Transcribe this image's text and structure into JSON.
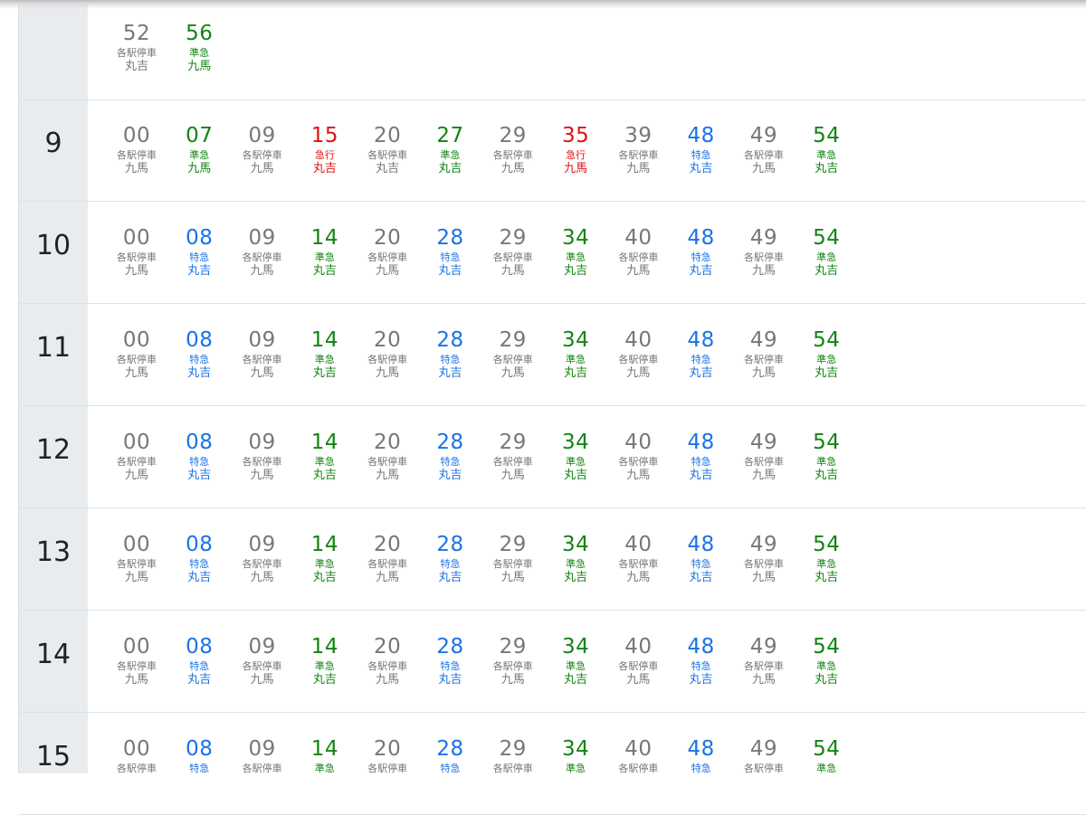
{
  "colors": {
    "local": "#777777",
    "semi_express": "#128412",
    "limited_express": "#1a73e8",
    "express": "#e01010"
  },
  "timetable": [
    {
      "hour": "",
      "trains": [
        {
          "minute": "52",
          "type": "各駅停車",
          "dest": "丸吉",
          "kind": "local"
        },
        {
          "minute": "56",
          "type": "準急",
          "dest": "九馬",
          "kind": "semi"
        }
      ]
    },
    {
      "hour": "9",
      "trains": [
        {
          "minute": "00",
          "type": "各駅停車",
          "dest": "九馬",
          "kind": "local"
        },
        {
          "minute": "07",
          "type": "準急",
          "dest": "九馬",
          "kind": "semi"
        },
        {
          "minute": "09",
          "type": "各駅停車",
          "dest": "九馬",
          "kind": "local"
        },
        {
          "minute": "15",
          "type": "急行",
          "dest": "丸吉",
          "kind": "exp"
        },
        {
          "minute": "20",
          "type": "各駅停車",
          "dest": "丸吉",
          "kind": "local"
        },
        {
          "minute": "27",
          "type": "準急",
          "dest": "丸吉",
          "kind": "semi"
        },
        {
          "minute": "29",
          "type": "各駅停車",
          "dest": "九馬",
          "kind": "local"
        },
        {
          "minute": "35",
          "type": "急行",
          "dest": "九馬",
          "kind": "exp"
        },
        {
          "minute": "39",
          "type": "各駅停車",
          "dest": "九馬",
          "kind": "local"
        },
        {
          "minute": "48",
          "type": "特急",
          "dest": "丸吉",
          "kind": "ltd"
        },
        {
          "minute": "49",
          "type": "各駅停車",
          "dest": "九馬",
          "kind": "local"
        },
        {
          "minute": "54",
          "type": "準急",
          "dest": "丸吉",
          "kind": "semi"
        }
      ]
    },
    {
      "hour": "10",
      "trains": [
        {
          "minute": "00",
          "type": "各駅停車",
          "dest": "九馬",
          "kind": "local"
        },
        {
          "minute": "08",
          "type": "特急",
          "dest": "丸吉",
          "kind": "ltd"
        },
        {
          "minute": "09",
          "type": "各駅停車",
          "dest": "九馬",
          "kind": "local"
        },
        {
          "minute": "14",
          "type": "準急",
          "dest": "丸吉",
          "kind": "semi"
        },
        {
          "minute": "20",
          "type": "各駅停車",
          "dest": "九馬",
          "kind": "local"
        },
        {
          "minute": "28",
          "type": "特急",
          "dest": "丸吉",
          "kind": "ltd"
        },
        {
          "minute": "29",
          "type": "各駅停車",
          "dest": "九馬",
          "kind": "local"
        },
        {
          "minute": "34",
          "type": "準急",
          "dest": "丸吉",
          "kind": "semi"
        },
        {
          "minute": "40",
          "type": "各駅停車",
          "dest": "九馬",
          "kind": "local"
        },
        {
          "minute": "48",
          "type": "特急",
          "dest": "丸吉",
          "kind": "ltd"
        },
        {
          "minute": "49",
          "type": "各駅停車",
          "dest": "九馬",
          "kind": "local"
        },
        {
          "minute": "54",
          "type": "準急",
          "dest": "丸吉",
          "kind": "semi"
        }
      ]
    },
    {
      "hour": "11",
      "trains": [
        {
          "minute": "00",
          "type": "各駅停車",
          "dest": "九馬",
          "kind": "local"
        },
        {
          "minute": "08",
          "type": "特急",
          "dest": "丸吉",
          "kind": "ltd"
        },
        {
          "minute": "09",
          "type": "各駅停車",
          "dest": "九馬",
          "kind": "local"
        },
        {
          "minute": "14",
          "type": "準急",
          "dest": "丸吉",
          "kind": "semi"
        },
        {
          "minute": "20",
          "type": "各駅停車",
          "dest": "九馬",
          "kind": "local"
        },
        {
          "minute": "28",
          "type": "特急",
          "dest": "丸吉",
          "kind": "ltd"
        },
        {
          "minute": "29",
          "type": "各駅停車",
          "dest": "九馬",
          "kind": "local"
        },
        {
          "minute": "34",
          "type": "準急",
          "dest": "丸吉",
          "kind": "semi"
        },
        {
          "minute": "40",
          "type": "各駅停車",
          "dest": "九馬",
          "kind": "local"
        },
        {
          "minute": "48",
          "type": "特急",
          "dest": "丸吉",
          "kind": "ltd"
        },
        {
          "minute": "49",
          "type": "各駅停車",
          "dest": "九馬",
          "kind": "local"
        },
        {
          "minute": "54",
          "type": "準急",
          "dest": "丸吉",
          "kind": "semi"
        }
      ]
    },
    {
      "hour": "12",
      "trains": [
        {
          "minute": "00",
          "type": "各駅停車",
          "dest": "九馬",
          "kind": "local"
        },
        {
          "minute": "08",
          "type": "特急",
          "dest": "丸吉",
          "kind": "ltd"
        },
        {
          "minute": "09",
          "type": "各駅停車",
          "dest": "九馬",
          "kind": "local"
        },
        {
          "minute": "14",
          "type": "準急",
          "dest": "丸吉",
          "kind": "semi"
        },
        {
          "minute": "20",
          "type": "各駅停車",
          "dest": "九馬",
          "kind": "local"
        },
        {
          "minute": "28",
          "type": "特急",
          "dest": "丸吉",
          "kind": "ltd"
        },
        {
          "minute": "29",
          "type": "各駅停車",
          "dest": "九馬",
          "kind": "local"
        },
        {
          "minute": "34",
          "type": "準急",
          "dest": "丸吉",
          "kind": "semi"
        },
        {
          "minute": "40",
          "type": "各駅停車",
          "dest": "九馬",
          "kind": "local"
        },
        {
          "minute": "48",
          "type": "特急",
          "dest": "丸吉",
          "kind": "ltd"
        },
        {
          "minute": "49",
          "type": "各駅停車",
          "dest": "九馬",
          "kind": "local"
        },
        {
          "minute": "54",
          "type": "準急",
          "dest": "丸吉",
          "kind": "semi"
        }
      ]
    },
    {
      "hour": "13",
      "trains": [
        {
          "minute": "00",
          "type": "各駅停車",
          "dest": "九馬",
          "kind": "local"
        },
        {
          "minute": "08",
          "type": "特急",
          "dest": "丸吉",
          "kind": "ltd"
        },
        {
          "minute": "09",
          "type": "各駅停車",
          "dest": "九馬",
          "kind": "local"
        },
        {
          "minute": "14",
          "type": "準急",
          "dest": "丸吉",
          "kind": "semi"
        },
        {
          "minute": "20",
          "type": "各駅停車",
          "dest": "九馬",
          "kind": "local"
        },
        {
          "minute": "28",
          "type": "特急",
          "dest": "丸吉",
          "kind": "ltd"
        },
        {
          "minute": "29",
          "type": "各駅停車",
          "dest": "九馬",
          "kind": "local"
        },
        {
          "minute": "34",
          "type": "準急",
          "dest": "丸吉",
          "kind": "semi"
        },
        {
          "minute": "40",
          "type": "各駅停車",
          "dest": "九馬",
          "kind": "local"
        },
        {
          "minute": "48",
          "type": "特急",
          "dest": "丸吉",
          "kind": "ltd"
        },
        {
          "minute": "49",
          "type": "各駅停車",
          "dest": "九馬",
          "kind": "local"
        },
        {
          "minute": "54",
          "type": "準急",
          "dest": "丸吉",
          "kind": "semi"
        }
      ]
    },
    {
      "hour": "14",
      "trains": [
        {
          "minute": "00",
          "type": "各駅停車",
          "dest": "九馬",
          "kind": "local"
        },
        {
          "minute": "08",
          "type": "特急",
          "dest": "丸吉",
          "kind": "ltd"
        },
        {
          "minute": "09",
          "type": "各駅停車",
          "dest": "九馬",
          "kind": "local"
        },
        {
          "minute": "14",
          "type": "準急",
          "dest": "丸吉",
          "kind": "semi"
        },
        {
          "minute": "20",
          "type": "各駅停車",
          "dest": "九馬",
          "kind": "local"
        },
        {
          "minute": "28",
          "type": "特急",
          "dest": "丸吉",
          "kind": "ltd"
        },
        {
          "minute": "29",
          "type": "各駅停車",
          "dest": "九馬",
          "kind": "local"
        },
        {
          "minute": "34",
          "type": "準急",
          "dest": "丸吉",
          "kind": "semi"
        },
        {
          "minute": "40",
          "type": "各駅停車",
          "dest": "九馬",
          "kind": "local"
        },
        {
          "minute": "48",
          "type": "特急",
          "dest": "丸吉",
          "kind": "ltd"
        },
        {
          "minute": "49",
          "type": "各駅停車",
          "dest": "九馬",
          "kind": "local"
        },
        {
          "minute": "54",
          "type": "準急",
          "dest": "丸吉",
          "kind": "semi"
        }
      ]
    },
    {
      "hour": "15",
      "trains": [
        {
          "minute": "00",
          "type": "各駅停車",
          "dest": "",
          "kind": "local"
        },
        {
          "minute": "08",
          "type": "特急",
          "dest": "",
          "kind": "ltd"
        },
        {
          "minute": "09",
          "type": "各駅停車",
          "dest": "",
          "kind": "local"
        },
        {
          "minute": "14",
          "type": "準急",
          "dest": "",
          "kind": "semi"
        },
        {
          "minute": "20",
          "type": "各駅停車",
          "dest": "",
          "kind": "local"
        },
        {
          "minute": "28",
          "type": "特急",
          "dest": "",
          "kind": "ltd"
        },
        {
          "minute": "29",
          "type": "各駅停車",
          "dest": "",
          "kind": "local"
        },
        {
          "minute": "34",
          "type": "準急",
          "dest": "",
          "kind": "semi"
        },
        {
          "minute": "40",
          "type": "各駅停車",
          "dest": "",
          "kind": "local"
        },
        {
          "minute": "48",
          "type": "特急",
          "dest": "",
          "kind": "ltd"
        },
        {
          "minute": "49",
          "type": "各駅停車",
          "dest": "",
          "kind": "local"
        },
        {
          "minute": "54",
          "type": "準急",
          "dest": "",
          "kind": "semi"
        }
      ]
    }
  ]
}
